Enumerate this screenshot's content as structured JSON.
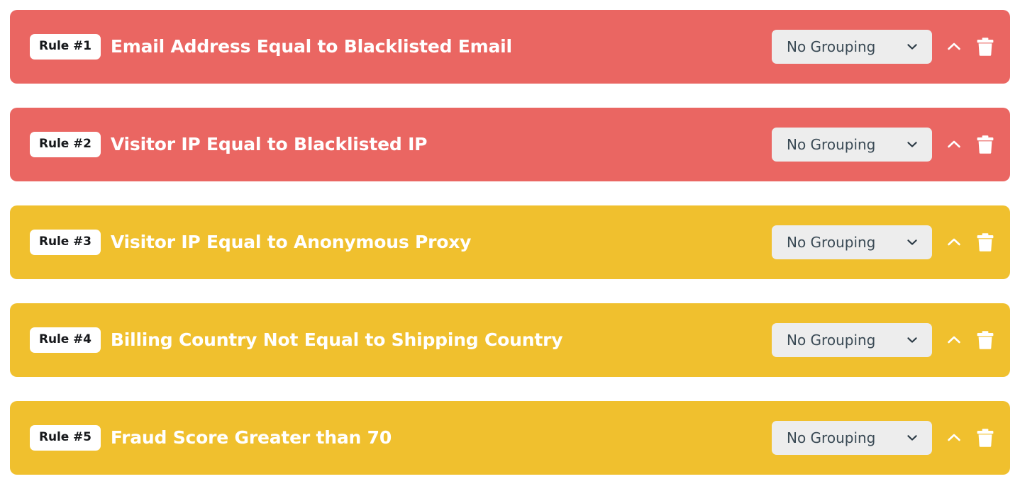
{
  "rules": [
    {
      "badge": "Rule #1",
      "title": "Email Address Equal to Blacklisted Email",
      "severity": "red",
      "severity_color": "#ea6662",
      "grouping_value": "No Grouping",
      "move_up_icon": "chevron-up-icon",
      "delete_icon": "trash-icon",
      "dropdown_icon": "chevron-down-icon"
    },
    {
      "badge": "Rule #2",
      "title": "Visitor IP Equal to Blacklisted IP",
      "severity": "red",
      "severity_color": "#ea6662",
      "grouping_value": "No Grouping",
      "move_up_icon": "chevron-up-icon",
      "delete_icon": "trash-icon",
      "dropdown_icon": "chevron-down-icon"
    },
    {
      "badge": "Rule #3",
      "title": "Visitor IP Equal to Anonymous Proxy",
      "severity": "yellow",
      "severity_color": "#f0c02e",
      "grouping_value": "No Grouping",
      "move_up_icon": "chevron-up-icon",
      "delete_icon": "trash-icon",
      "dropdown_icon": "chevron-down-icon"
    },
    {
      "badge": "Rule #4",
      "title": "Billing Country Not Equal to Shipping Country",
      "severity": "yellow",
      "severity_color": "#f0c02e",
      "grouping_value": "No Grouping",
      "move_up_icon": "chevron-up-icon",
      "delete_icon": "trash-icon",
      "dropdown_icon": "chevron-down-icon"
    },
    {
      "badge": "Rule #5",
      "title": "Fraud Score Greater than 70",
      "severity": "yellow",
      "severity_color": "#f0c02e",
      "grouping_value": "No Grouping",
      "move_up_icon": "chevron-up-icon",
      "delete_icon": "trash-icon",
      "dropdown_icon": "chevron-down-icon"
    }
  ],
  "theme": {
    "background": "#ffffff",
    "badge_background": "#ffffff",
    "badge_text": "#17191c",
    "title_text": "#ffffff",
    "dropdown_background": "#ededed",
    "dropdown_text": "#3a4a55",
    "icon_color": "#ffffff"
  }
}
